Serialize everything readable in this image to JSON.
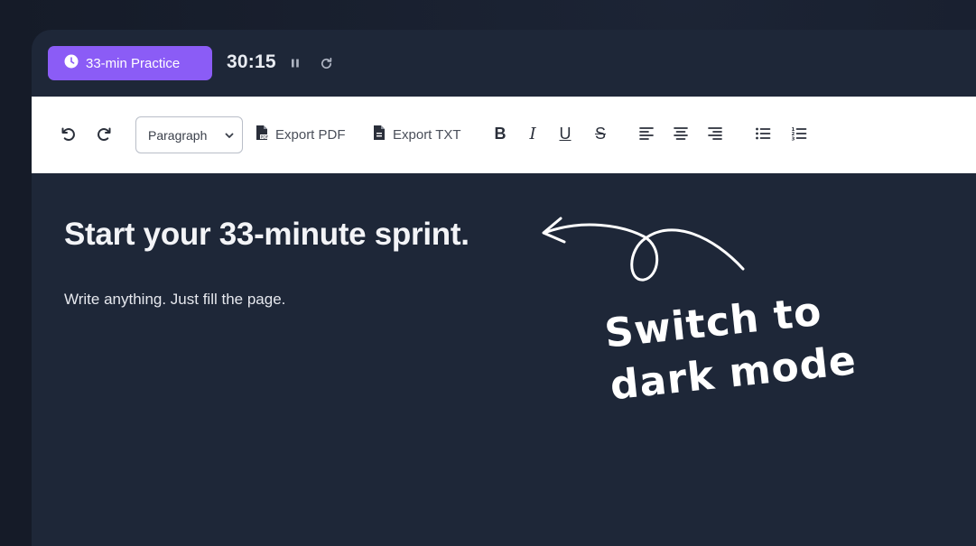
{
  "header": {
    "practice_label": "33-min Practice",
    "timer": "30:15"
  },
  "toolbar": {
    "block_select_value": "Paragraph",
    "export_pdf_label": "Export PDF",
    "export_txt_label": "Export TXT",
    "bold_glyph": "B",
    "italic_glyph": "I",
    "underline_glyph": "U",
    "strike_glyph": "S"
  },
  "editor": {
    "heading": "Start your 33-minute sprint.",
    "body": "Write anything. Just fill the page."
  },
  "callout": {
    "line1": "Switch to",
    "line2": "dark mode"
  },
  "colors": {
    "accent": "#8b5cf6",
    "editor_bg": "#1e2738",
    "toolbar_bg": "#ffffff"
  },
  "icons": [
    "clock-icon",
    "pause-icon",
    "reset-icon",
    "undo-icon",
    "redo-icon",
    "chevron-down-icon",
    "pdf-file-icon",
    "txt-file-icon",
    "align-left-icon",
    "align-center-icon",
    "align-right-icon",
    "bullet-list-icon",
    "numbered-list-icon",
    "curly-arrow-icon"
  ]
}
